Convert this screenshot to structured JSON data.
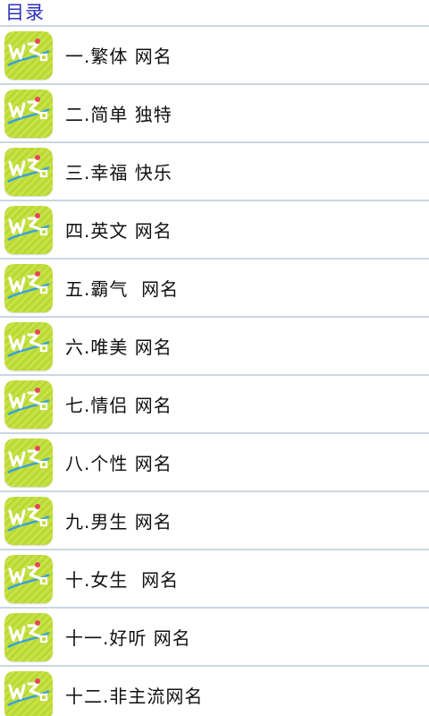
{
  "header": {
    "title": "目录"
  },
  "colors": {
    "title": "#2a32b8",
    "divider": "#c9d6e3",
    "icon_bg": "#b9d832",
    "icon_text": "#ffffff",
    "icon_accent": "#e8455a"
  },
  "list": {
    "icon_name": "app-logo-icon",
    "items": [
      {
        "label": "一.繁体 网名"
      },
      {
        "label": "二.简单 独特"
      },
      {
        "label": "三.幸福 快乐"
      },
      {
        "label": "四.英文 网名"
      },
      {
        "label": "五.霸气  网名"
      },
      {
        "label": "六.唯美 网名"
      },
      {
        "label": "七.情侣 网名"
      },
      {
        "label": "八.个性 网名"
      },
      {
        "label": "九.男生 网名"
      },
      {
        "label": "十.女生  网名"
      },
      {
        "label": "十一.好听 网名"
      },
      {
        "label": "十二.非主流网名"
      }
    ]
  }
}
